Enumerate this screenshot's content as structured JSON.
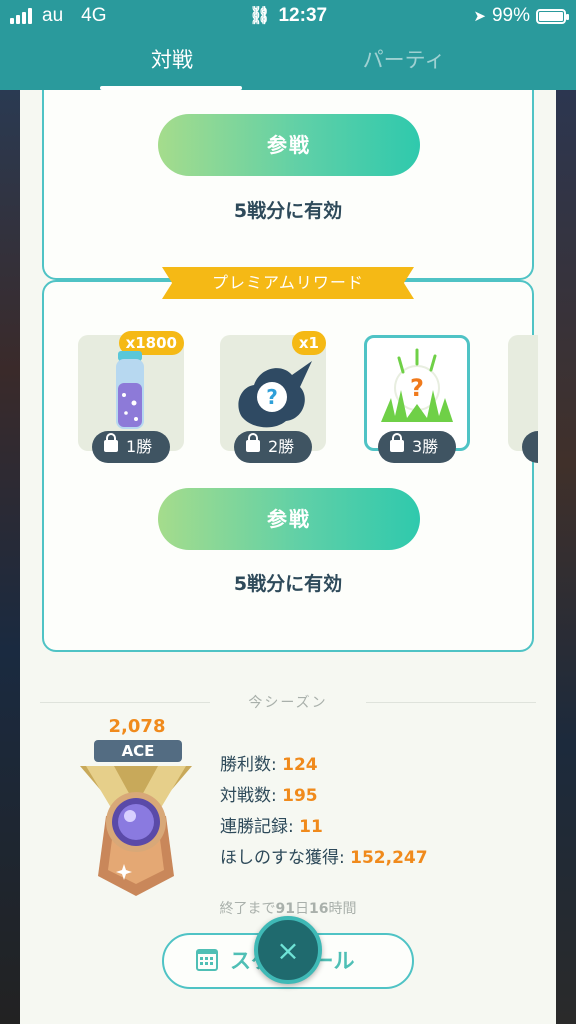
{
  "status_bar": {
    "carrier": "au",
    "network": "4G",
    "time": "12:37",
    "battery": "99%",
    "battery_level": 0.99
  },
  "tabs": [
    {
      "label": "対戦",
      "active": true
    },
    {
      "label": "パーティ",
      "active": false
    }
  ],
  "free_section": {
    "join_label": "参戦",
    "valid_text": "5戦分に有効"
  },
  "premium_section": {
    "banner": "プレミアムリワード",
    "rewards": [
      {
        "icon": "stardust-icon",
        "qty": "x1800",
        "wins": "1勝",
        "locked": true
      },
      {
        "icon": "mystery-encounter-icon",
        "qty": "x1",
        "wins": "2勝",
        "locked": true
      },
      {
        "icon": "mystery-grass-icon",
        "qty": "",
        "wins": "3勝",
        "locked": true,
        "selected": true
      }
    ],
    "join_label": "参戦",
    "valid_text": "5戦分に有効"
  },
  "season": {
    "label": "今シーズン",
    "rating": "2,078",
    "rank": "ACE",
    "medal_icon": "bronze-medal-icon",
    "stats": [
      {
        "label": "勝利数:",
        "value": "124"
      },
      {
        "label": "対戦数:",
        "value": "195"
      },
      {
        "label": "連勝記録:",
        "value": "11"
      },
      {
        "label": "ほしのすな獲得:",
        "value": "152,247"
      }
    ],
    "end_prefix": "終了まで",
    "end_days": "91",
    "end_days_unit": "日",
    "end_hours": "16",
    "end_hours_unit": "時間",
    "schedule_label": "スケジュール"
  },
  "close_label": "×",
  "colors": {
    "teal": "#2a9a9c",
    "accent": "#4fc3c5",
    "gold": "#f5b915",
    "orange_value": "#f08a1c",
    "text_dark": "#2e4a5a"
  }
}
